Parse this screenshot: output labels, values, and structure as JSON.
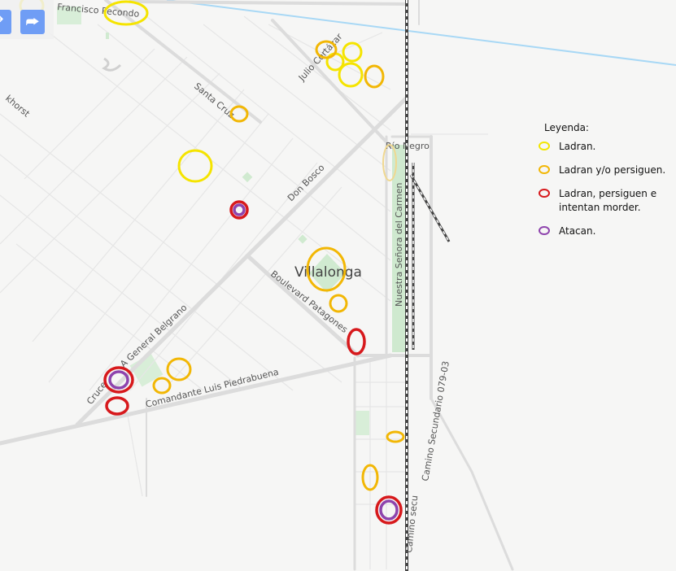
{
  "map": {
    "streets": [
      "Francisco Pecondo",
      "Julio Cortázar",
      "Santa Cruz",
      "Don Bosco",
      "Río Negro",
      "Nuestra Señora del Carmen",
      "Boulevard Patagones",
      "Cruce",
      "A General Belgrano",
      "Comandante Luis Piedrabuena",
      "Camino Secundario 079-03",
      "Camino secu",
      "khorst"
    ],
    "town_label": "Villalonga"
  },
  "legend": {
    "title": "Leyenda:",
    "items": [
      {
        "label": "Ladran.",
        "color": "#f2e600"
      },
      {
        "label": "Ladran y/o persiguen.",
        "color": "#f2b705"
      },
      {
        "label": "Ladran, persiguen e intentan morder.",
        "color": "#d7191c"
      },
      {
        "label": "Atacan.",
        "color": "#8e44ad"
      }
    ]
  },
  "toolbar": {
    "icons": [
      "partial-button-icon",
      "turn-right-icon"
    ]
  }
}
